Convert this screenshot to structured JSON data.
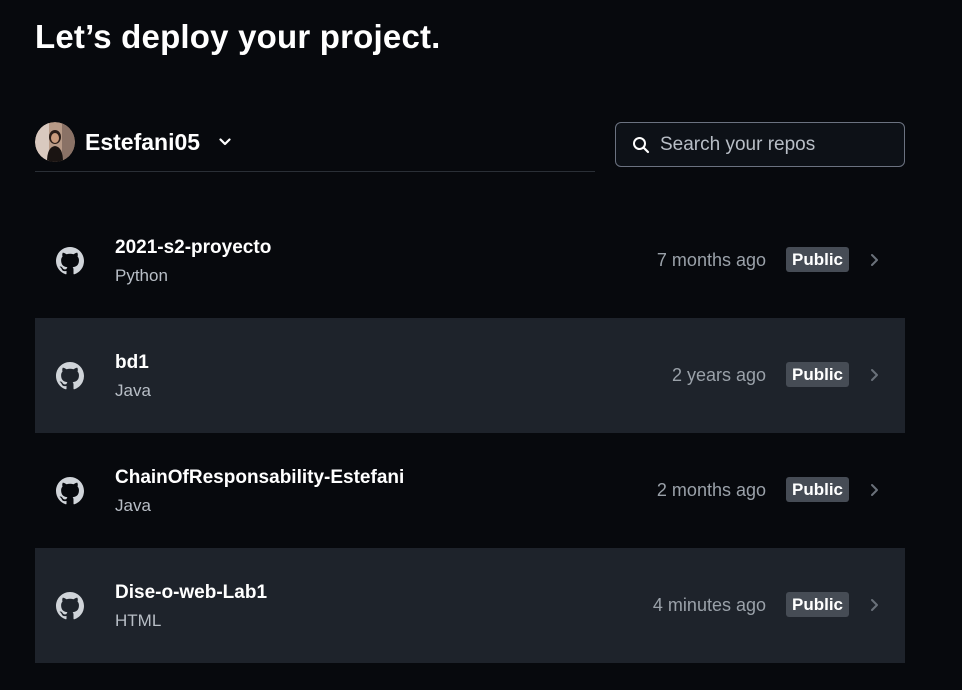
{
  "page": {
    "title": "Let’s deploy your project."
  },
  "account": {
    "name": "Estefani05",
    "avatar_icon": "user-avatar-photo",
    "dropdown_icon": "chevron-down-icon"
  },
  "search": {
    "placeholder": "Search your repos",
    "value": "",
    "icon": "search-icon"
  },
  "repos": [
    {
      "name": "2021-s2-proyecto",
      "language": "Python",
      "updated": "7 months ago",
      "visibility": "Public"
    },
    {
      "name": "bd1",
      "language": "Java",
      "updated": "2 years ago",
      "visibility": "Public"
    },
    {
      "name": "ChainOfResponsability-Estefani",
      "language": "Java",
      "updated": "2 months ago",
      "visibility": "Public"
    },
    {
      "name": "Dise-o-web-Lab1",
      "language": "HTML",
      "updated": "4 minutes ago",
      "visibility": "Public"
    }
  ],
  "colors": {
    "background": "#07090d",
    "row_alt": "#1e232b",
    "badge": "#464c55",
    "muted_text": "#9aa1a9"
  }
}
